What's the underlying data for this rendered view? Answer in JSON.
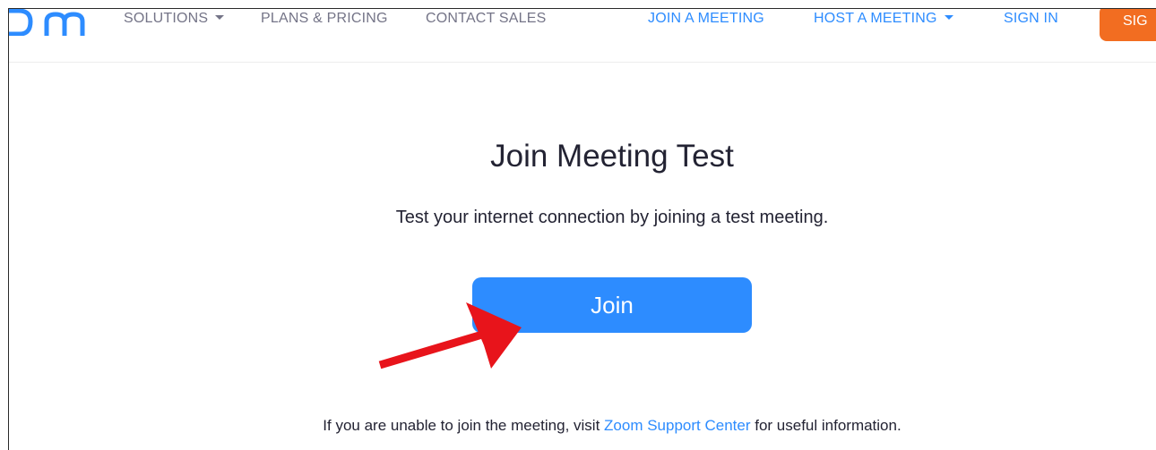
{
  "header": {
    "logo_icon": "zoom-logo-icon",
    "nav_left": [
      {
        "label": "SOLUTIONS",
        "has_dropdown": true
      },
      {
        "label": "PLANS & PRICING",
        "has_dropdown": false
      },
      {
        "label": "CONTACT SALES",
        "has_dropdown": false
      }
    ],
    "nav_right": [
      {
        "label": "JOIN A MEETING",
        "has_dropdown": false
      },
      {
        "label": "HOST A MEETING",
        "has_dropdown": true
      },
      {
        "label": "SIGN IN",
        "has_dropdown": false
      }
    ],
    "signup_label": "SIG"
  },
  "main": {
    "title": "Join Meeting Test",
    "subtitle": "Test your internet connection by joining a test meeting.",
    "join_label": "Join",
    "footer_prefix": "If you are unable to join the meeting, visit ",
    "footer_link": "Zoom Support Center",
    "footer_suffix": " for useful information."
  },
  "colors": {
    "brand_blue": "#2d8cff",
    "signup_orange": "#f26d21",
    "nav_grey": "#747487",
    "text_dark": "#232333",
    "annotation_arrow": "#e8141b"
  }
}
